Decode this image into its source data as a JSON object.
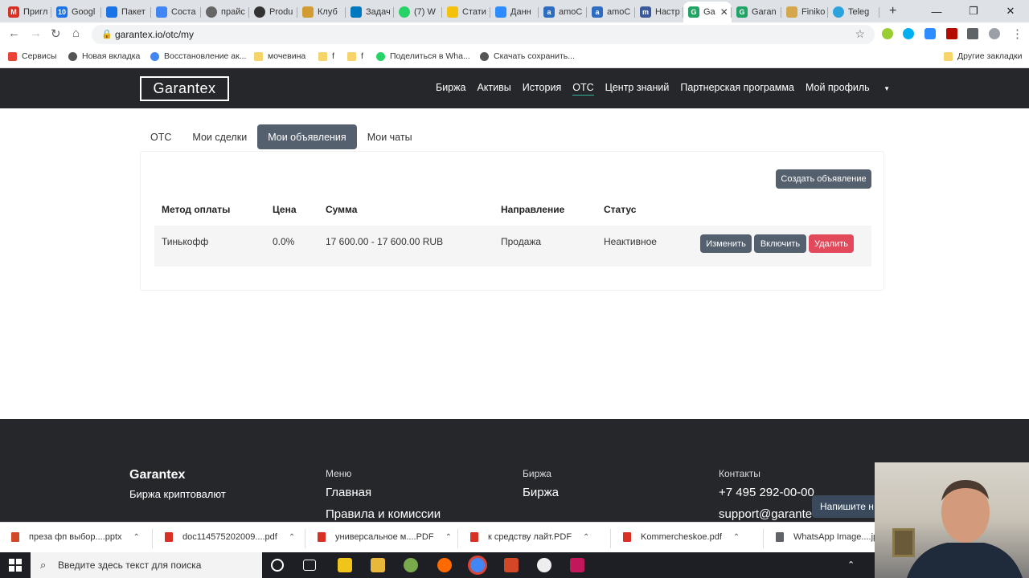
{
  "browser": {
    "tabs": [
      {
        "label": "Пригл",
        "icon": "gmail-icon",
        "color": "#d93025"
      },
      {
        "label": "Googl",
        "icon": "calendar-icon",
        "color": "#1a73e8"
      },
      {
        "label": "Пакет",
        "icon": "drive-icon",
        "color": "#1a73e8"
      },
      {
        "label": "Соста",
        "icon": "docs-icon",
        "color": "#4285f4"
      },
      {
        "label": "прайс",
        "icon": "globe-icon",
        "color": "#555"
      },
      {
        "label": "Produ",
        "icon": "producthunt-icon",
        "color": "#333"
      },
      {
        "label": "Клуб",
        "icon": "handshake-icon",
        "color": "#d39c33"
      },
      {
        "label": "Задач",
        "icon": "trello-icon",
        "color": "#0079bf"
      },
      {
        "label": "(7) W",
        "icon": "whatsapp-icon",
        "color": "#25d366"
      },
      {
        "label": "Стати",
        "icon": "yandex-metrica-icon",
        "color": "#f4c20d"
      },
      {
        "label": "Данн",
        "icon": "zoom-icon",
        "color": "#2d8cff"
      },
      {
        "label": "amoC",
        "icon": "amocrm-icon",
        "color": "#2d6cc0"
      },
      {
        "label": "amoC",
        "icon": "amocrm-icon",
        "color": "#2d6cc0"
      },
      {
        "label": "Настр",
        "icon": "m-icon",
        "color": "#3b5998"
      },
      {
        "label": "Ga",
        "icon": "garantex-icon",
        "color": "#1fa463",
        "active": true
      },
      {
        "label": "Garan",
        "icon": "garantex-icon",
        "color": "#1fa463"
      },
      {
        "label": "Finiko",
        "icon": "finiko-icon",
        "color": "#d4a84a"
      },
      {
        "label": "Teleg",
        "icon": "telegram-icon",
        "color": "#2aa3df"
      }
    ],
    "url": "garantex.io/otc/my",
    "bookmarks": [
      {
        "label": "Сервисы",
        "icon": "apps-icon",
        "color": "#e94335"
      },
      {
        "label": "Новая вкладка",
        "icon": "globe-icon",
        "color": "#555"
      },
      {
        "label": "Восстановление ак...",
        "icon": "google-icon",
        "color": "#4285f4"
      },
      {
        "label": "мочевина",
        "icon": "folder-icon",
        "color": "#f6d36b"
      },
      {
        "label": "f",
        "icon": "folder-icon",
        "color": "#f6d36b"
      },
      {
        "label": "f",
        "icon": "folder-icon",
        "color": "#f6d36b"
      },
      {
        "label": "Поделиться в Wha...",
        "icon": "whatsapp-icon",
        "color": "#25d366"
      },
      {
        "label": "Скачать сохранить...",
        "icon": "download-icon",
        "color": "#555"
      }
    ],
    "other_bookmarks": "Другие закладки"
  },
  "site": {
    "logo": "Garantex",
    "nav": [
      "Биржа",
      "Активы",
      "История",
      "OTC",
      "Центр знаний",
      "Партнерская программа",
      "Мой профиль"
    ],
    "nav_active": "OTC",
    "accent": "#2fb59e"
  },
  "subtabs": [
    "OTC",
    "Мои сделки",
    "Мои объявления",
    "Мои чаты"
  ],
  "subtab_active": "Мои объявления",
  "create_button": "Создать объявление",
  "table": {
    "headers": [
      "Метод оплаты",
      "Цена",
      "Сумма",
      "Направление",
      "Статус"
    ],
    "rows": [
      {
        "method": "Тинькофф",
        "price": "0.0%",
        "amount": "17 600.00 - 17 600.00 RUB",
        "direction": "Продажа",
        "status": "Неактивное"
      }
    ],
    "actions": {
      "edit": "Изменить",
      "enable": "Включить",
      "delete": "Удалить"
    }
  },
  "footer": {
    "brand": "Garantex",
    "tagline": "Биржа криптовалют",
    "menu_title": "Меню",
    "menu_links": [
      "Главная",
      "Правила и комиссии"
    ],
    "exchange_title": "Биржа",
    "exchange_links": [
      "Биржа"
    ],
    "contacts_title": "Контакты",
    "phone": "+7 495 292-00-00",
    "email": "support@garante",
    "chat_widget": "Напишите н"
  },
  "downloads": [
    {
      "name": "преза фп выбор....pptx",
      "color": "#d24726"
    },
    {
      "name": "doc114575202009....pdf",
      "color": "#d93025"
    },
    {
      "name": "универсальное м....PDF",
      "color": "#d93025"
    },
    {
      "name": "к средству лайт.PDF",
      "color": "#d93025"
    },
    {
      "name": "Kommercheskoe.pdf",
      "color": "#d93025"
    },
    {
      "name": "WhatsApp Image....jp",
      "color": "#5f6368"
    }
  ],
  "taskbar": {
    "search_placeholder": "Введите здесь текст для поиска"
  }
}
